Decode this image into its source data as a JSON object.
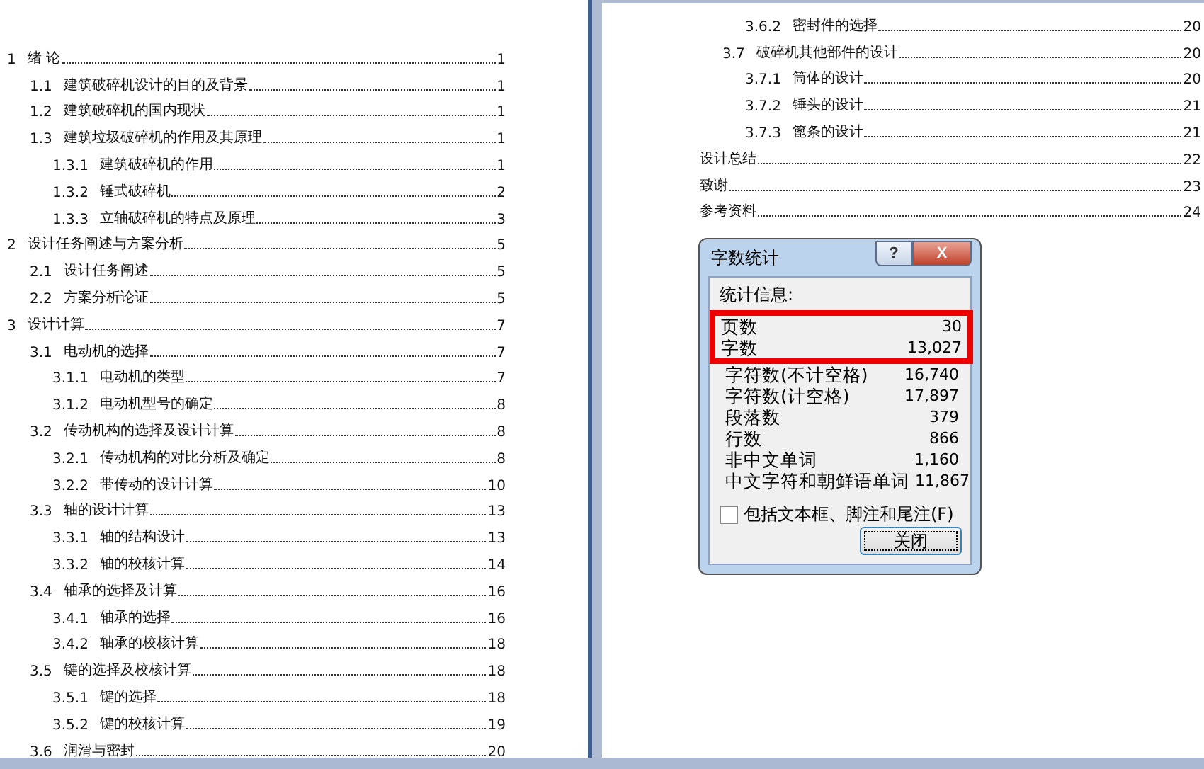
{
  "pages": [
    {
      "entries": [
        {
          "number": "1",
          "title": "绪 论",
          "page": "1",
          "children": [
            {
              "number": "1.1",
              "title": "建筑破碎机设计的目的及背景",
              "page": "1"
            },
            {
              "number": "1.2",
              "title": "建筑破碎机的国内现状",
              "page": "1"
            },
            {
              "number": "1.3",
              "title": "建筑垃圾破碎机的作用及其原理",
              "page": "1",
              "children": [
                {
                  "number": "1.3.1",
                  "title": "建筑破碎机的作用",
                  "page": "1"
                },
                {
                  "number": "1.3.2",
                  "title": "锤式破碎机",
                  "page": "2"
                },
                {
                  "number": "1.3.3",
                  "title": "立轴破碎机的特点及原理",
                  "page": "3"
                }
              ]
            }
          ]
        },
        {
          "number": "2",
          "title": "设计任务阐述与方案分析",
          "page": "5",
          "children": [
            {
              "number": "2.1",
              "title": "设计任务阐述",
              "page": "5"
            },
            {
              "number": "2.2",
              "title": "方案分析论证",
              "page": "5"
            }
          ]
        },
        {
          "number": "3",
          "title": "设计计算",
          "page": "7",
          "children": [
            {
              "number": "3.1",
              "title": "电动机的选择",
              "page": "7",
              "children": [
                {
                  "number": "3.1.1",
                  "title": "电动机的类型",
                  "page": "7"
                },
                {
                  "number": "3.1.2",
                  "title": "电动机型号的确定",
                  "page": "8"
                }
              ]
            },
            {
              "number": "3.2",
              "title": "传动机构的选择及设计计算",
              "page": "8",
              "children": [
                {
                  "number": "3.2.1",
                  "title": "传动机构的对比分析及确定",
                  "page": "8"
                },
                {
                  "number": "3.2.2",
                  "title": "带传动的设计计算",
                  "page": "10"
                }
              ]
            },
            {
              "number": "3.3",
              "title": "轴的设计计算",
              "page": "13",
              "children": [
                {
                  "number": "3.3.1",
                  "title": "轴的结构设计",
                  "page": "13"
                },
                {
                  "number": "3.3.2",
                  "title": "轴的校核计算",
                  "page": "14"
                }
              ]
            },
            {
              "number": "3.4",
              "title": "轴承的选择及计算",
              "page": "16",
              "children": [
                {
                  "number": "3.4.1",
                  "title": "轴承的选择",
                  "page": "16"
                },
                {
                  "number": "3.4.2",
                  "title": "轴承的校核计算",
                  "page": "18"
                }
              ]
            },
            {
              "number": "3.5",
              "title": "键的选择及校核计算",
              "page": "18",
              "children": [
                {
                  "number": "3.5.1",
                  "title": "键的选择",
                  "page": "18"
                },
                {
                  "number": "3.5.2",
                  "title": "键的校核计算",
                  "page": "19"
                }
              ]
            },
            {
              "number": "3.6",
              "title": "润滑与密封",
              "page": "20"
            }
          ]
        }
      ]
    },
    {
      "entries": [
        {
          "children": [
            {
              "children": [
                {
                  "number": "3.6.2",
                  "title": "密封件的选择",
                  "page": "20"
                }
              ]
            },
            {
              "number": "3.7",
              "title": "破碎机其他部件的设计",
              "page": "20",
              "children": [
                {
                  "number": "3.7.1",
                  "title": "筒体的设计",
                  "page": "20"
                },
                {
                  "number": "3.7.2",
                  "title": "锤头的设计",
                  "page": "21"
                },
                {
                  "number": "3.7.3",
                  "title": "篦条的设计",
                  "page": "21"
                }
              ]
            }
          ]
        },
        {
          "title": "设计总结",
          "page": "22"
        },
        {
          "title": "致谢",
          "page": "23"
        },
        {
          "title": "参考资料",
          "page": "24"
        }
      ]
    }
  ],
  "dialog": {
    "title": "字数统计",
    "help_button": "?",
    "close_button": "X",
    "group_label": "统计信息:",
    "stats": [
      {
        "label": "页数",
        "value": "30",
        "highlighted": true
      },
      {
        "label": "字数",
        "value": "13,027",
        "highlighted": true
      },
      {
        "label": "字符数(不计空格)",
        "value": "16,740",
        "highlighted": false
      },
      {
        "label": "字符数(计空格)",
        "value": "17,897",
        "highlighted": false
      },
      {
        "label": "段落数",
        "value": "379",
        "highlighted": false
      },
      {
        "label": "行数",
        "value": "866",
        "highlighted": false
      },
      {
        "label": "非中文单词",
        "value": "1,160",
        "highlighted": false
      },
      {
        "label": "中文字符和朝鲜语单词",
        "value": "11,867",
        "highlighted": false
      }
    ],
    "checkbox": {
      "label": "包括文本框、脚注和尾注(F)",
      "checked": false
    },
    "button": "关闭"
  }
}
